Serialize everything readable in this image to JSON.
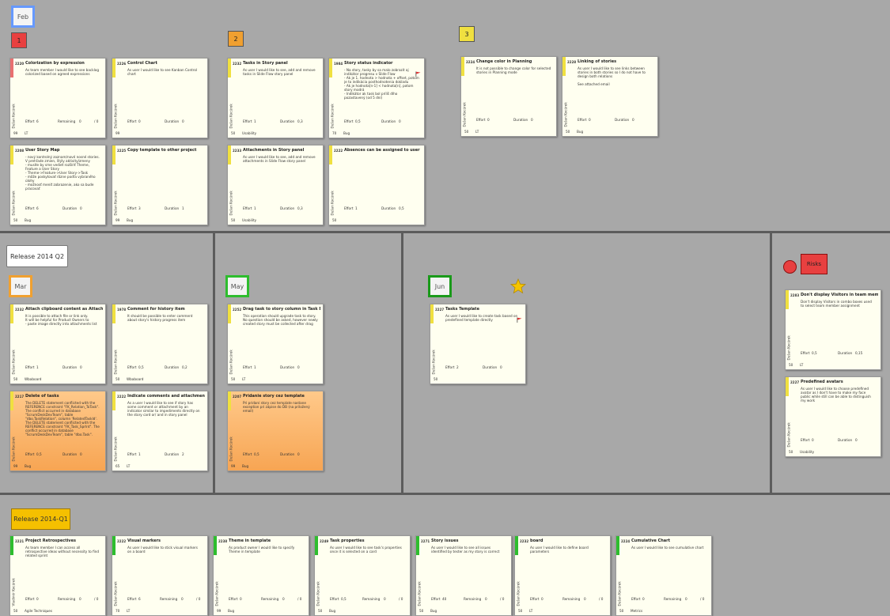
{
  "board": {
    "release_q2": "Release 2014 Q2",
    "release_q1": "Release 2014-Q1",
    "risks": "Risks",
    "colors": {
      "red": "#e84040",
      "yellow": "#f0e040",
      "green": "#2ebd2e",
      "orange_month": "#f0a030",
      "month_feb": "#6699ff"
    }
  },
  "top": {
    "month": "Feb",
    "prio1": "1",
    "prio2": "2",
    "prio3": "3"
  },
  "mid": {
    "mar": "Mar",
    "may": "May",
    "jun": "Jun"
  },
  "cards": [
    {
      "id": "2220",
      "title": "Colorization by expression",
      "desc": "As team member I would like to see backlog colorized based on agreed expressions",
      "owner": "Dušan Kocúrek",
      "effort_label": "Effort",
      "effort": "6",
      "rem_label": "Remaining",
      "rem": "0",
      "of": "/ 0",
      "pts": "99",
      "cat": "LT"
    },
    {
      "id": "2226",
      "title": "Control Chart",
      "desc": "As user I would like to see Kanban Control chart",
      "owner": "Dušan Kocúrek",
      "effort_label": "Effort",
      "effort": "0",
      "dur_label": "Duration",
      "dur": "0",
      "pts": "99",
      "cat": ""
    },
    {
      "id": "2232",
      "title": "Tasks in Story panel",
      "desc": "As user I would like to see, add and remove tasks in Slide Flow story panel",
      "owner": "Dušan Kocúrek",
      "effort_label": "Effort",
      "effort": "1",
      "dur_label": "Duration",
      "dur": "0,3",
      "pts": "50",
      "cat": "Usability"
    },
    {
      "id": "1984",
      "title": "Story status indicator",
      "desc": "- Na story, tasky by sa malo zobrazit aj indikátor progresu v Slide Flow\n- Ak je 1. hodnota > hodnota + offset, potom je to indikácia posthodnotenia dokladu\n- Ak je hodnota[n-1] < hodnota[n], potom story modrá\n- Indikátor ak task bol príliš dlho pozastavený (od 5 dní)",
      "owner": "Dušan Kocúrek",
      "effort_label": "Effort",
      "effort": "0,5",
      "dur_label": "Duration",
      "dur": "0",
      "pts": "70",
      "cat": "Bug",
      "flag": true
    },
    {
      "id": "2208",
      "title": "User Story Map",
      "desc": "- nový kontrolný zoznam/nové nosné stories. V prehľade zmien, štýly aktivity/zmeny\n- musíte by sme vedieť rozšíriť Theme, Feature a User Story\n- Theme->Feature->User Story->Task\n- môže poskytovať rôzne podľa vybraného úlohy\n- možnosť meniť zobrazenie, ako sa bude pracovať",
      "owner": "Dušan Kocúrek",
      "effort_label": "Effort",
      "effort": "6",
      "dur_label": "Duration",
      "dur": "0",
      "pts": "50",
      "cat": "Bug"
    },
    {
      "id": "2225",
      "title": "Copy template to other project",
      "desc": "",
      "owner": "Dušan Kocúrek",
      "effort_label": "Effort",
      "effort": "3",
      "dur_label": "Duration",
      "dur": "1",
      "pts": "99",
      "cat": "Bug"
    },
    {
      "id": "2233",
      "title": "Attachments in Story panel",
      "desc": "As user I would like to see, add and remove attachments in Slide Flow story panel",
      "owner": "Dušan Kocúrek",
      "effort_label": "Effort",
      "effort": "1",
      "dur_label": "Duration",
      "dur": "0,3",
      "pts": "50",
      "cat": "Usability"
    },
    {
      "id": "2222",
      "title": "Absences can be assigned to user",
      "desc": "",
      "owner": "Dušan Kocúrek",
      "effort_label": "Effort",
      "effort": "1",
      "dur_label": "Duration",
      "dur": "0,5",
      "pts": "50",
      "cat": ""
    },
    {
      "id": "2224",
      "title": "Change color in Planning",
      "desc": "It is not possible to change color for selected stories in Planning mode",
      "owner": "Dušan Kocúrek",
      "effort_label": "Effort",
      "effort": "0",
      "dur_label": "Duration",
      "dur": "0",
      "pts": "50",
      "cat": "LT"
    },
    {
      "id": "2228",
      "title": "Linking of stories",
      "desc": "As user I would like to see links between stories in both stories so I do not have to design both relations\n\nSee attached email",
      "owner": "Dušan Kocúrek",
      "effort_label": "Effort",
      "effort": "0",
      "dur_label": "Duration",
      "dur": "0",
      "pts": "50",
      "cat": "Bug"
    },
    {
      "id": "2232",
      "title": "Attach clipboard content as Attachment of st",
      "desc": "It is possible to attach file or link only.\nIt will be helpful for Product Owners to\n- paste image directly into attachments list",
      "owner": "Dušan Kocúrek",
      "effort_label": "Effort",
      "effort": "1",
      "dur_label": "Duration",
      "dur": "0",
      "pts": "50",
      "cat": "Wbaboard"
    },
    {
      "id": "1978",
      "title": "Comment for history item",
      "desc": "It should be possible to enter comment about story's history progress item",
      "owner": "Dušan Kocúrek",
      "effort_label": "Effort",
      "effort": "0,5",
      "dur_label": "Duration",
      "dur": "0,2",
      "pts": "50",
      "cat": "Wbaboard"
    },
    {
      "id": "2217",
      "title": "Delete of tasks",
      "desc": "The DELETE statement conflicted with the REFERENCE constraint \"FK_Relation_ToTask\". The conflict occurred in database \"ScrumDeskDevTeam\", table \"dbo.TaskRelation\", column 'RelatedTaskId'.\nThe DELETE statement conflicted with the REFERENCE constraint \"FK_Task_SprInt\". The conflict occurred in database \"ScrumDeskDevTeam\", table \"dbo.Task\".",
      "owner": "Dušan Kocúrek",
      "effort_label": "Effort",
      "effort": "0,5",
      "dur_label": "Duration",
      "dur": "0",
      "pts": "99",
      "cat": "Bug",
      "orange": true
    },
    {
      "id": "2222",
      "title": "Indicate comments and attachments of story",
      "desc": "As a user I would like to see if story has some comment or attachment by an indicator similar to impediments directly on the story card or/ and in story panel",
      "owner": "Dušan Kocúrek",
      "effort_label": "Effort",
      "effort": "1",
      "dur_label": "Duration",
      "dur": "2",
      "pts": "65",
      "cat": "LT"
    },
    {
      "id": "2252",
      "title": "Drag task to story column in Task Board view",
      "desc": "This operation should upgrade task to story. No question should be asked, however newly created story must be collected after drag",
      "owner": "Dušan Kocúrek",
      "effort_label": "Effort",
      "effort": "1",
      "dur_label": "Duration",
      "dur": "0",
      "pts": "50",
      "cat": "LT"
    },
    {
      "id": "2207",
      "title": "Pridanie story cez template",
      "desc": "Pri pridaní story cez template nastane exception pri zápise do DB (na priložený email)",
      "owner": "Dušan Kocúrek",
      "effort_label": "Effort",
      "effort": "0,5",
      "dur_label": "Duration",
      "dur": "0",
      "pts": "99",
      "cat": "Bug",
      "orange": true
    },
    {
      "id": "2227",
      "title": "Tasks Template",
      "desc": "As user I would like to create task based on predefined template directly",
      "owner": "Dušan Kocúrek",
      "effort_label": "Effort",
      "effort": "2",
      "dur_label": "Duration",
      "dur": "0",
      "pts": "50",
      "cat": "",
      "flag": true
    },
    {
      "id": "2283",
      "title": "Don't display Visitors in team members com!",
      "desc": "Don't display Visitors in combo boxes used to select team member assignment",
      "owner": "Dušan Kocúrek",
      "effort_label": "Effort",
      "effort": "0,5",
      "dur_label": "Duration",
      "dur": "0,15",
      "pts": "50",
      "cat": "LT"
    },
    {
      "id": "2227",
      "title": "Predefined avatars",
      "desc": "As user I would like to choose predefined avatar as I don't have to make my face public while still can be able to distinguish my work",
      "owner": "Dušan Kocúrek",
      "effort_label": "Effort",
      "effort": "0",
      "dur_label": "Duration",
      "dur": "0",
      "pts": "50",
      "cat": "Usability"
    },
    {
      "id": "2221",
      "title": "Project Retrospectives",
      "desc": "As team member I can access all retrospective ideas without necessity to find related sprint",
      "owner": "Vladimír Kocúrek",
      "effort_label": "Effort",
      "effort": "0",
      "rem_label": "Remaining",
      "rem": "0",
      "of": "/ 0",
      "pts": "50",
      "cat": "Agile Techniques"
    },
    {
      "id": "2222",
      "title": "Visual markers",
      "desc": "As user I would like to stick visual markers on a board",
      "owner": "Dušan Kocúrek",
      "effort_label": "Effort",
      "effort": "6",
      "rem_label": "Remaining",
      "rem": "0",
      "of": "/ 0",
      "pts": "70",
      "cat": "LT"
    },
    {
      "id": "2238",
      "title": "Theme in template",
      "desc": "As product owner I would like to specify Theme in template",
      "owner": "Dušan Kocúrek",
      "effort_label": "Effort",
      "effort": "0",
      "rem_label": "Remaining",
      "rem": "0",
      "of": "/ 0",
      "pts": "99",
      "cat": "Bug"
    },
    {
      "id": "2249",
      "title": "Task properties",
      "desc": "As user I would like to see task's properties once it is selected on a card",
      "owner": "Dušan Kocúrek",
      "effort_label": "Effort",
      "effort": "0,5",
      "rem_label": "Remaining",
      "rem": "0",
      "of": "/ 0",
      "pts": "50",
      "cat": "Bug"
    },
    {
      "id": "2271",
      "title": "Story issues",
      "desc": "As user I would like to see all issues identified by tester as my story is correct",
      "owner": "Dušan Kocúrek",
      "effort_label": "Effort",
      "effort": "40",
      "rem_label": "Remaining",
      "rem": "0",
      "of": "/ 0",
      "pts": "50",
      "cat": "Bug"
    },
    {
      "id": "2232",
      "title": "board",
      "desc": "As user I would like to define board parameters",
      "owner": "Dušan Kocúrek",
      "effort_label": "Effort",
      "effort": "0",
      "rem_label": "Remaining",
      "rem": "0",
      "of": "/ 0",
      "pts": "50",
      "cat": "LT"
    },
    {
      "id": "2224",
      "title": "Cumulative Chart",
      "desc": "As user I would like to see cumulative chart",
      "owner": "Dušan Kocúrek",
      "effort_label": "Effort",
      "effort": "0",
      "rem_label": "Remaining",
      "rem": "0",
      "of": "/ 0",
      "pts": "50",
      "cat": "Metrics"
    }
  ]
}
